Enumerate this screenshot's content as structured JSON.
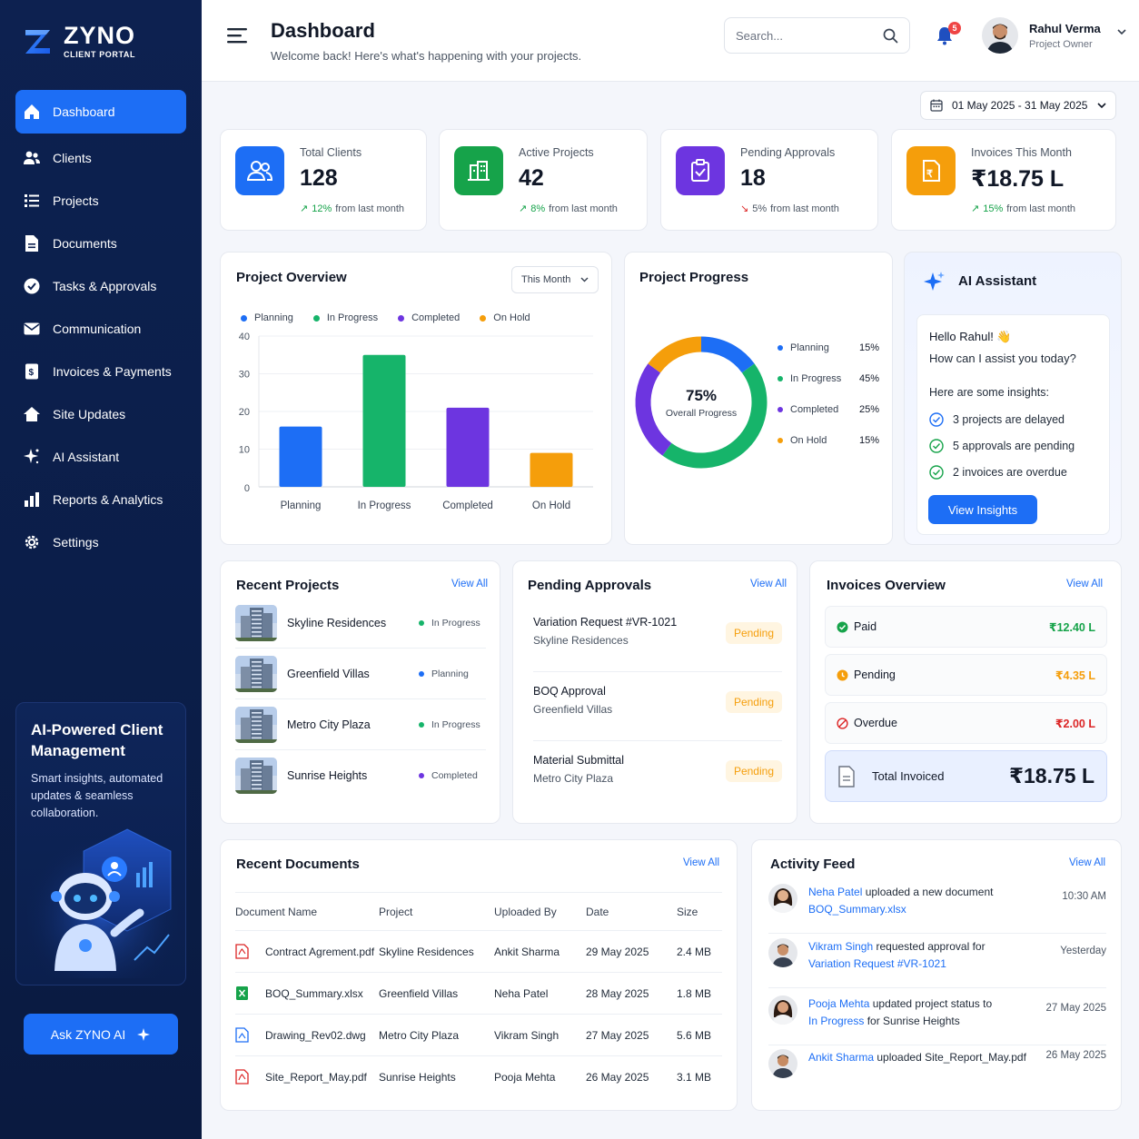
{
  "brand": {
    "name": "ZYNO",
    "subtitle": "CLIENT PORTAL"
  },
  "nav": [
    {
      "label": "Dashboard",
      "icon": "home-icon",
      "active": true
    },
    {
      "label": "Clients",
      "icon": "users-icon"
    },
    {
      "label": "Projects",
      "icon": "list-icon"
    },
    {
      "label": "Documents",
      "icon": "document-icon"
    },
    {
      "label": "Tasks & Approvals",
      "icon": "check-circle-icon"
    },
    {
      "label": "Communication",
      "icon": "mail-icon"
    },
    {
      "label": "Invoices & Payments",
      "icon": "invoice-icon"
    },
    {
      "label": "Site Updates",
      "icon": "house-icon"
    },
    {
      "label": "AI Assistant",
      "icon": "sparkle-icon"
    },
    {
      "label": "Reports & Analytics",
      "icon": "bar-chart-icon"
    },
    {
      "label": "Settings",
      "icon": "gear-icon"
    }
  ],
  "promo": {
    "title": "AI-Powered Client Management",
    "desc": "Smart insights, automated updates & seamless collaboration."
  },
  "ask_button": "Ask ZYNO AI",
  "header": {
    "title": "Dashboard",
    "subtitle": "Welcome back! Here's what's happening with your projects.",
    "search_placeholder": "Search...",
    "notification_count": "5",
    "user_name": "Rahul Verma",
    "user_role": "Project Owner"
  },
  "date_range": "01 May 2025 - 31 May 2025",
  "stats": [
    {
      "label": "Total Clients",
      "value": "128",
      "delta": "12%",
      "delta_text": "from last month",
      "trend": "up",
      "color": "#1d6ef5"
    },
    {
      "label": "Active Projects",
      "value": "42",
      "delta": "8%",
      "delta_text": "from last month",
      "trend": "up",
      "color": "#16a34a"
    },
    {
      "label": "Pending Approvals",
      "value": "18",
      "delta": "5%",
      "delta_text": "from last month",
      "trend": "down",
      "color": "#6d28d9"
    },
    {
      "label": "Invoices This Month",
      "value": "₹18.75 L",
      "delta": "15%",
      "delta_text": "from last month",
      "trend": "up",
      "color": "#f59e0b"
    }
  ],
  "overview": {
    "title": "Project Overview",
    "filter": "This Month"
  },
  "chart_data": [
    {
      "type": "bar",
      "title": "Project Overview",
      "categories": [
        "Planning",
        "In Progress",
        "Completed",
        "On Hold"
      ],
      "values": [
        16,
        35,
        21,
        9
      ],
      "colors": [
        "#1d6ef5",
        "#16b46a",
        "#6d35e0",
        "#f59e0b"
      ],
      "ylim": [
        0,
        40
      ],
      "yticks": [
        "0",
        "10",
        "20",
        "30",
        "40"
      ],
      "legend": "top",
      "grid": true
    },
    {
      "type": "pie",
      "title": "Project Progress",
      "center_value": "75%",
      "center_label": "Overall Progress",
      "categories": [
        "Planning",
        "In Progress",
        "Completed",
        "On Hold"
      ],
      "values": [
        15,
        45,
        25,
        15
      ],
      "labels": [
        "15%",
        "45%",
        "25%",
        "15%"
      ],
      "colors": [
        "#1d6ef5",
        "#16b46a",
        "#6d35e0",
        "#f59e0b"
      ]
    }
  ],
  "progress": {
    "title": "Project Progress"
  },
  "ai": {
    "title": "AI Assistant",
    "greeting": "Hello Rahul! 👋",
    "question": "How can I assist you today?",
    "insights_label": "Here are some insights:",
    "insights": [
      "3 projects are delayed",
      "5 approvals are pending",
      "2 invoices are overdue"
    ],
    "button": "View Insights"
  },
  "recent_projects": {
    "title": "Recent Projects",
    "view_all": "View All",
    "items": [
      {
        "name": "Skyline Residences",
        "status": "In Progress",
        "color": "#16b46a"
      },
      {
        "name": "Greenfield Villas",
        "status": "Planning",
        "color": "#1d6ef5"
      },
      {
        "name": "Metro City Plaza",
        "status": "In Progress",
        "color": "#16b46a"
      },
      {
        "name": "Sunrise Heights",
        "status": "Completed",
        "color": "#6d35e0"
      }
    ]
  },
  "pending_approvals": {
    "title": "Pending Approvals",
    "view_all": "View All",
    "items": [
      {
        "title": "Variation Request #VR-1021",
        "project": "Skyline Residences",
        "status": "Pending"
      },
      {
        "title": "BOQ Approval",
        "project": "Greenfield Villas",
        "status": "Pending"
      },
      {
        "title": "Material Submittal",
        "project": "Metro City Plaza",
        "status": "Pending"
      }
    ]
  },
  "invoices": {
    "title": "Invoices Overview",
    "view_all": "View All",
    "items": [
      {
        "label": "Paid",
        "amount": "₹12.40 L",
        "color": "#16a34a"
      },
      {
        "label": "Pending",
        "amount": "₹4.35 L",
        "color": "#f59e0b"
      },
      {
        "label": "Overdue",
        "amount": "₹2.00 L",
        "color": "#dc2626"
      }
    ],
    "total_label": "Total Invoiced",
    "total_value": "₹18.75 L"
  },
  "documents": {
    "title": "Recent Documents",
    "view_all": "View All",
    "columns": [
      "Document Name",
      "Project",
      "Uploaded By",
      "Date",
      "Size"
    ],
    "rows": [
      {
        "name": "Contract Agrement.pdf",
        "type": "pdf",
        "project": "Skyline Residences",
        "by": "Ankit Sharma",
        "date": "29 May 2025",
        "size": "2.4 MB"
      },
      {
        "name": "BOQ_Summary.xlsx",
        "type": "xlsx",
        "project": "Greenfield Villas",
        "by": "Neha Patel",
        "date": "28 May 2025",
        "size": "1.8 MB"
      },
      {
        "name": "Drawing_Rev02.dwg",
        "type": "dwg",
        "project": "Metro City Plaza",
        "by": "Vikram Singh",
        "date": "27 May 2025",
        "size": "5.6 MB"
      },
      {
        "name": "Site_Report_May.pdf",
        "type": "pdf",
        "project": "Sunrise Heights",
        "by": "Pooja Mehta",
        "date": "26 May 2025",
        "size": "3.1 MB"
      }
    ]
  },
  "activity": {
    "title": "Activity Feed",
    "view_all": "View All",
    "items": [
      {
        "user": "Neha Patel",
        "text": " uploaded a new document",
        "link": "BOQ_Summary.xlsx",
        "after": "",
        "time": "10:30 AM"
      },
      {
        "user": "Vikram Singh",
        "text": " requested approval for",
        "link": "Variation Request #VR-1021",
        "after": "",
        "time": "Yesterday"
      },
      {
        "user": "Pooja Mehta",
        "text": " updated project status to",
        "link": "In Progress",
        "after": " for Sunrise Heights",
        "time": "27 May 2025"
      },
      {
        "user": "Ankit Sharma",
        "text": " uploaded Site_Report_May.pdf",
        "link": "",
        "after": "",
        "time": "26 May 2025"
      }
    ]
  }
}
